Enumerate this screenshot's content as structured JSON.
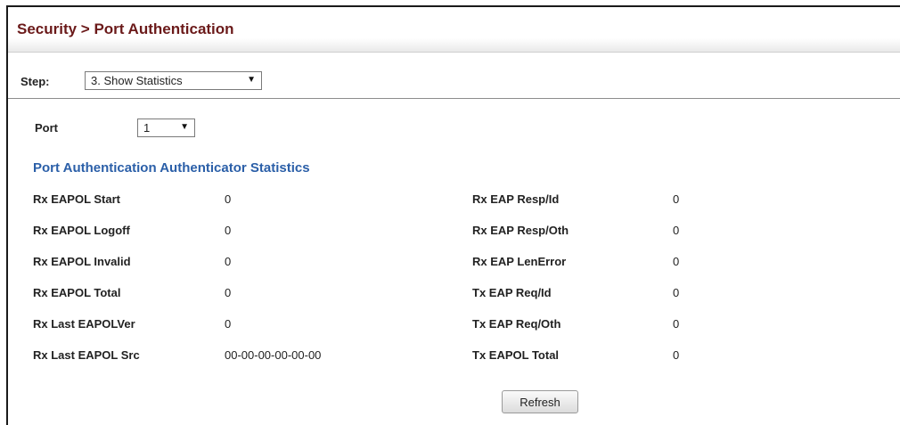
{
  "header": {
    "title": "Security > Port Authentication"
  },
  "step": {
    "label": "Step:",
    "selected": "3. Show Statistics"
  },
  "port": {
    "label": "Port",
    "selected": "1"
  },
  "section": {
    "title": "Port Authentication Authenticator Statistics"
  },
  "stats": {
    "left": [
      {
        "label": "Rx EAPOL Start",
        "value": "0"
      },
      {
        "label": "Rx EAPOL Logoff",
        "value": "0"
      },
      {
        "label": "Rx EAPOL Invalid",
        "value": "0"
      },
      {
        "label": "Rx EAPOL Total",
        "value": "0"
      },
      {
        "label": "Rx Last EAPOLVer",
        "value": "0"
      },
      {
        "label": "Rx Last EAPOL Src",
        "value": "00-00-00-00-00-00"
      }
    ],
    "right": [
      {
        "label": "Rx EAP Resp/Id",
        "value": "0"
      },
      {
        "label": "Rx EAP Resp/Oth",
        "value": "0"
      },
      {
        "label": "Rx EAP LenError",
        "value": "0"
      },
      {
        "label": "Tx EAP Req/Id",
        "value": "0"
      },
      {
        "label": "Tx EAP Req/Oth",
        "value": "0"
      },
      {
        "label": "Tx EAPOL Total",
        "value": "0"
      }
    ]
  },
  "actions": {
    "refresh_label": "Refresh"
  }
}
